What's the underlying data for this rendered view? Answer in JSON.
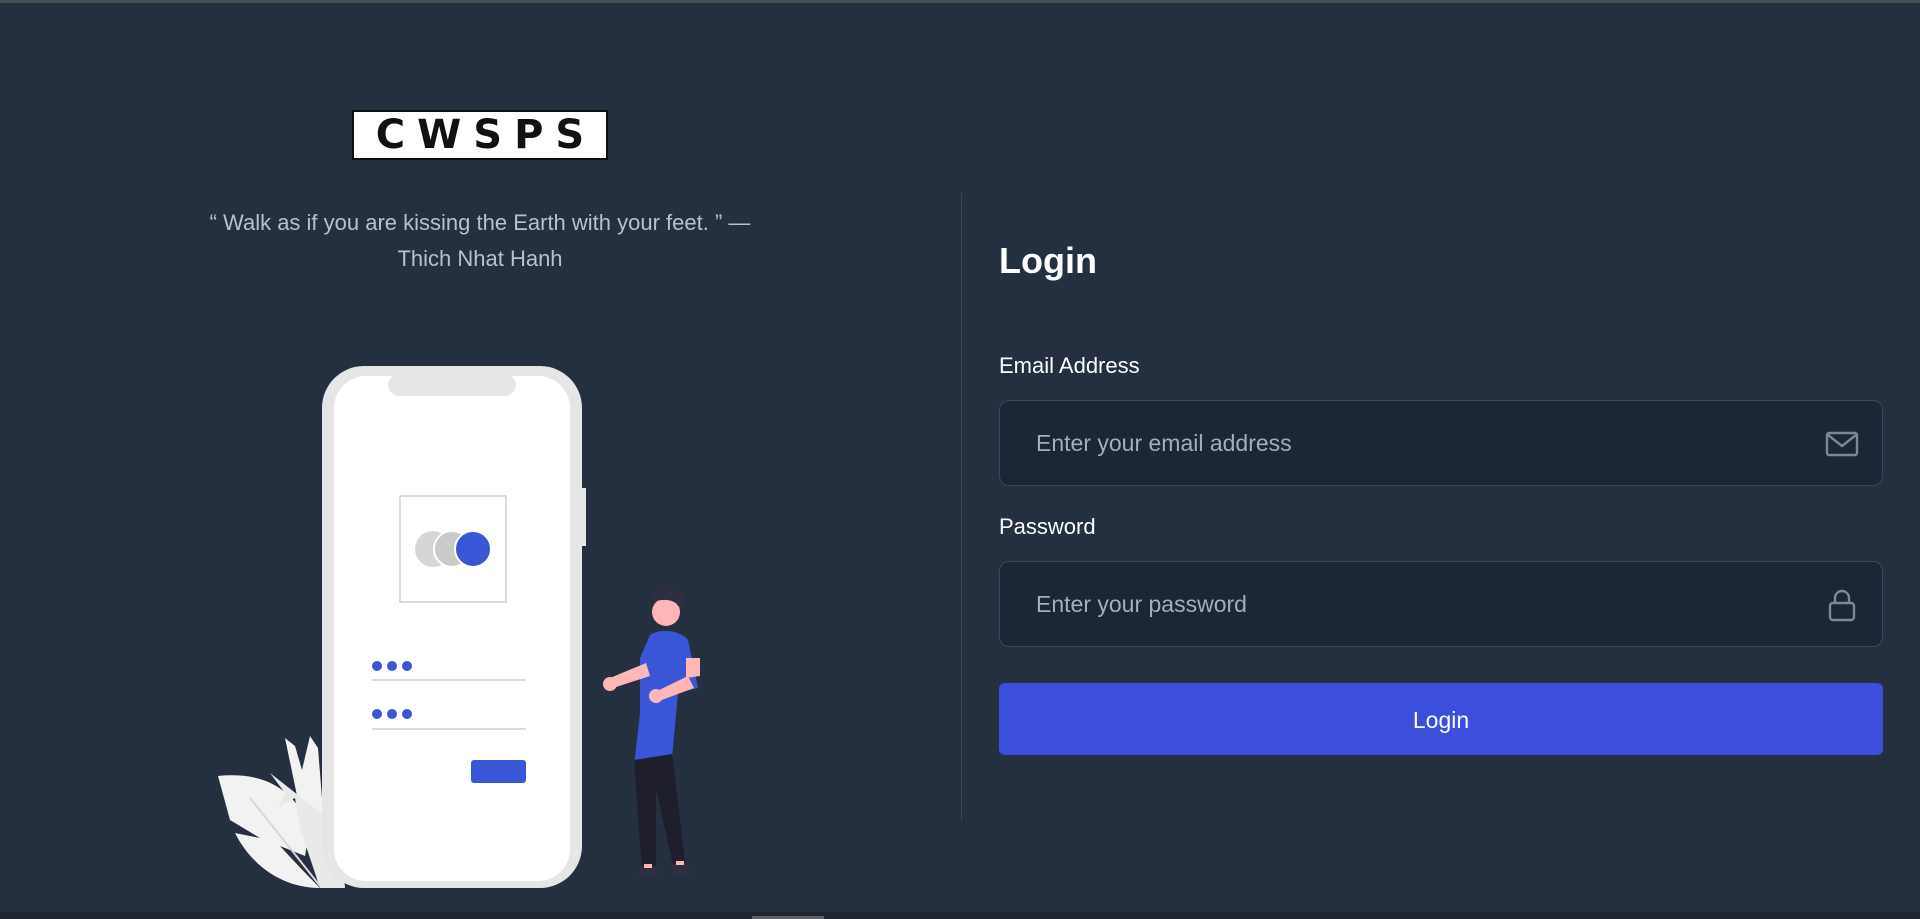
{
  "brand": {
    "logo_text": "CWSPS"
  },
  "quote": {
    "text": "“ Walk as if you are kissing the Earth with your feet. ” —",
    "author": "Thich Nhat Hanh"
  },
  "login": {
    "title": "Login",
    "email": {
      "label": "Email Address",
      "placeholder": "Enter your email address",
      "value": "",
      "icon": "mail-icon"
    },
    "password": {
      "label": "Password",
      "placeholder": "Enter your password",
      "value": "",
      "icon": "lock-icon"
    },
    "submit_label": "Login"
  },
  "colors": {
    "background": "#242f40",
    "accent": "#3b4fdc",
    "input_background": "#1d2636",
    "text": "#ffffff",
    "muted_text": "#b9c0cc"
  }
}
